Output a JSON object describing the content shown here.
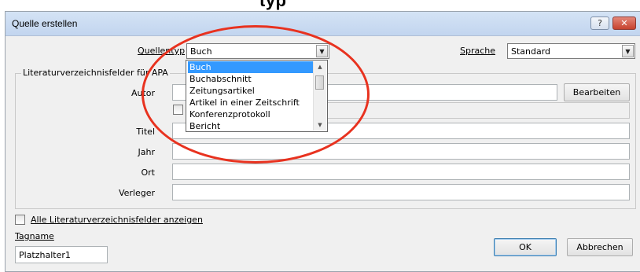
{
  "overlay_title": "typ",
  "window": {
    "title": "Quelle erstellen",
    "help_label": "?",
    "close_label": "✕"
  },
  "source_type": {
    "label": "Quellentyp",
    "value": "Buch",
    "options": [
      "Buch",
      "Buchabschnitt",
      "Zeitungsartikel",
      "Artikel in einer Zeitschrift",
      "Konferenzprotokoll",
      "Bericht"
    ],
    "selected_index": 0
  },
  "language": {
    "label": "Sprache",
    "value": "Standard"
  },
  "group": {
    "legend": "Literaturverzeichnisfelder für APA"
  },
  "fields": {
    "author_label": "Autor",
    "title_label": "Titel",
    "year_label": "Jahr",
    "place_label": "Ort",
    "publisher_label": "Verleger",
    "author_value": "",
    "title_value": "",
    "year_value": "",
    "place_value": "",
    "publisher_value": ""
  },
  "buttons": {
    "edit": "Bearbeiten",
    "ok": "OK",
    "cancel": "Abbrechen"
  },
  "show_all": {
    "label": "Alle Literaturverzeichnisfelder anzeigen",
    "checked": false
  },
  "tag": {
    "label": "Tagname",
    "value": "Platzhalter1"
  },
  "annotation_color": "#e8321f"
}
